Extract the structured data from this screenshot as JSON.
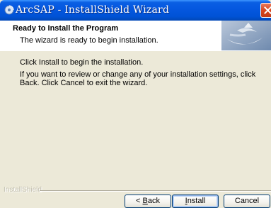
{
  "window": {
    "title": "ArcSAP - InstallShield Wizard",
    "title_icon": "installer-icon",
    "close_icon": "close-icon"
  },
  "banner": {
    "title": "Ready to Install the Program",
    "description": "The wizard is ready to begin installation.",
    "art_icon": "installshield-banner-art"
  },
  "content": {
    "line1": "Click Install to begin the installation.",
    "line2": "If you want to review or change any of your installation settings, click Back. Click Cancel to exit the wizard."
  },
  "footer": {
    "brand": "InstallShield"
  },
  "buttons": {
    "back": {
      "prefix": "< ",
      "accel": "B",
      "rest": "ack"
    },
    "install": {
      "accel": "I",
      "rest": "nstall"
    },
    "cancel": {
      "label": "Cancel"
    }
  },
  "colors": {
    "titlebar": "#0558e0",
    "dialog_bg": "#ece9d8",
    "close_button": "#d8461f",
    "banner_bg": "#ffffff"
  }
}
